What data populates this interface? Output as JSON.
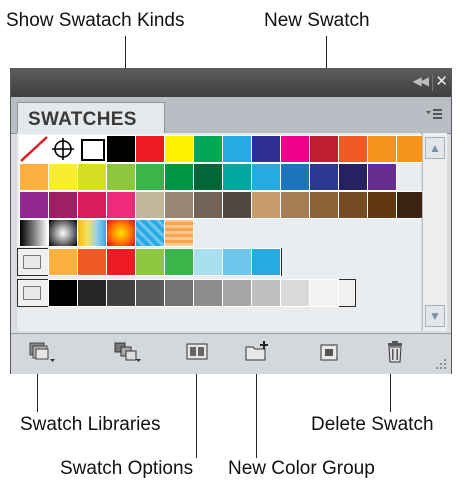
{
  "callouts": {
    "show_swatch_kinds": "Show Swatach Kinds",
    "new_swatch": "New Swatch",
    "swatch_libraries": "Swatch Libraries",
    "delete_swatch": "Delete Swatch",
    "swatch_options": "Swatch Options",
    "new_color_group": "New Color Group"
  },
  "panel": {
    "tab_label": "SWATCHES",
    "collapse_icon": "double-chevron-left-icon",
    "close_icon": "close-icon",
    "menu_icon": "panel-menu-icon"
  },
  "swatches": {
    "row1": [
      "none",
      "registration",
      "#ffffff",
      "#000000",
      "#ed1c24",
      "#fff200",
      "#00a651",
      "#27aae1",
      "#2e3192",
      "#ec008c",
      "#be1e2d",
      "#f15a24",
      "#f7941d",
      "#f7941d"
    ],
    "row2": [
      "#fbb040",
      "#f9ed32",
      "#d7df23",
      "#8dc63f",
      "#39b54a",
      "#009444",
      "#006838",
      "#00a79d",
      "#27aae1",
      "#1c75bc",
      "#2b3990",
      "#262262",
      "#662d91"
    ],
    "row3": [
      "#92278f",
      "#9e1f63",
      "#da1c5c",
      "#ee2a7b",
      "#c2b59b",
      "#998675",
      "#736357",
      "#534741",
      "#c69c6d",
      "#a67c52",
      "#8c6239",
      "#754c24",
      "#603913",
      "#3c2415"
    ],
    "row4_gradients": [
      "#000000-#ffffff",
      "#ffffff-#000000",
      "#fdb813-#36a9e1",
      "#ff0000-#f7941d",
      "pattern-blue",
      "pattern-orange"
    ],
    "group1": [
      "#fbb040",
      "#f15a24",
      "#ed1c24",
      "#8dc63f",
      "#39b54a",
      "#a8e0f0",
      "#6ec6ea",
      "#27aae1"
    ],
    "group2": [
      "#000000",
      "#262626",
      "#404040",
      "#595959",
      "#737373",
      "#8c8c8c",
      "#a6a6a6",
      "#bfbfbf",
      "#d9d9d9",
      "#f2f2f2"
    ]
  },
  "toolbar": {
    "icons": [
      "swatch-libraries-icon",
      "show-swatch-kinds-icon",
      "swatch-options-icon",
      "new-color-group-icon",
      "new-swatch-icon",
      "delete-swatch-icon"
    ]
  }
}
